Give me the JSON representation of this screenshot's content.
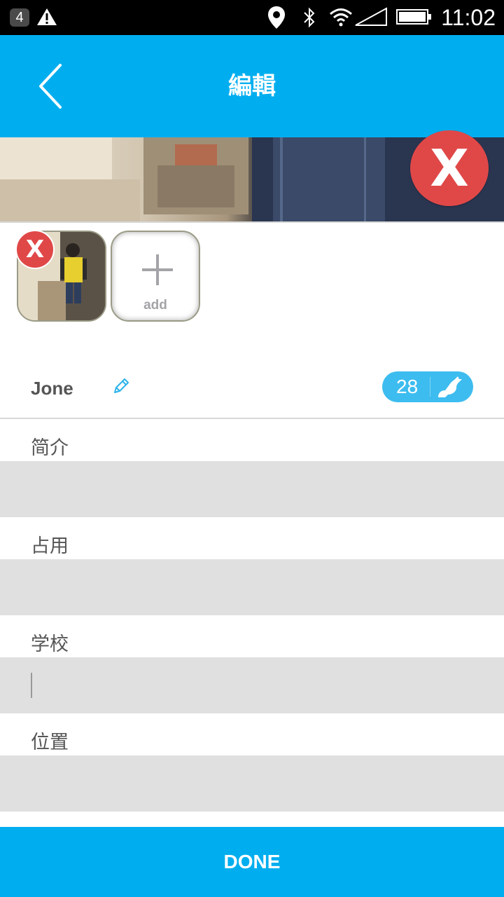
{
  "status_bar": {
    "notification_count": "4",
    "time": "11:02",
    "icons": [
      "alert-icon",
      "location-icon",
      "bluetooth-icon",
      "wifi-icon",
      "signal-icon",
      "battery-icon"
    ]
  },
  "header": {
    "title": "編輯",
    "back_icon": "chevron-left-icon"
  },
  "photos": {
    "cover_remove_label": "X",
    "thumb_remove_label": "X",
    "add_label": "add"
  },
  "profile": {
    "name": "Jone",
    "age": "28",
    "zodiac_icon": "capricorn-icon"
  },
  "fields": [
    {
      "label": "简介",
      "value": ""
    },
    {
      "label": "占用",
      "value": ""
    },
    {
      "label": "学校",
      "value": ""
    },
    {
      "label": "位置",
      "value": ""
    }
  ],
  "footer": {
    "done_label": "DONE"
  },
  "colors": {
    "primary": "#00aeef",
    "remove": "#e04848",
    "badge": "#3dbcef",
    "input_bg": "#e0e0e0"
  }
}
